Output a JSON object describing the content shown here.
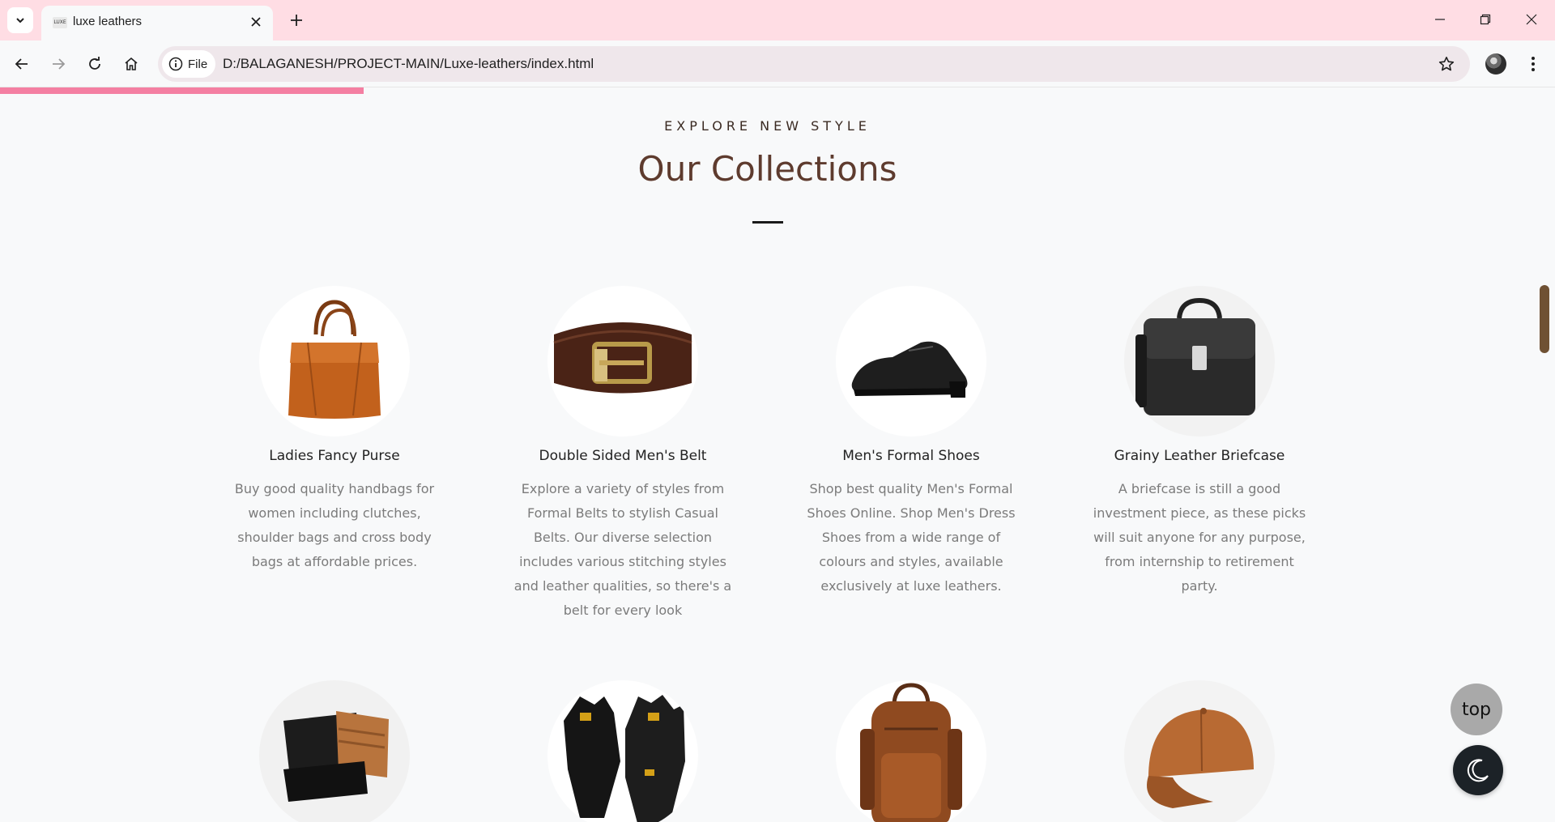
{
  "browser": {
    "tab_title": "luxe leathers",
    "tab_favicon_text": "LUXE",
    "file_chip_label": "File",
    "url": "D:/BALAGANESH/PROJECT-MAIN/Luxe-leathers/index.html"
  },
  "page": {
    "scroll_progress_percent": 23.4,
    "eyebrow": "EXPLORE NEW STYLE",
    "heading": "Our Collections",
    "collections": [
      {
        "title": "Ladies Fancy Purse",
        "description": "Buy good quality handbags for women including clutches, shoulder bags and cross body bags at affordable prices.",
        "icon": "handbag-image"
      },
      {
        "title": "Double Sided Men's Belt",
        "description": "Explore a variety of styles from Formal Belts to stylish Casual Belts. Our diverse selection includes various stitching styles and leather qualities, so there's a belt for every look",
        "icon": "belt-image"
      },
      {
        "title": "Men's Formal Shoes",
        "description": "Shop best quality Men's Formal Shoes Online. Shop Men's Dress Shoes from a wide range of colours and styles, available exclusively at luxe leathers.",
        "icon": "shoe-image"
      },
      {
        "title": "Grainy Leather Briefcase",
        "description": "A briefcase is still a good investment piece, as these picks will suit anyone for any purpose, from internship to retirement party.",
        "icon": "briefcase-image"
      },
      {
        "icon": "wallet-image"
      },
      {
        "icon": "gloves-image"
      },
      {
        "icon": "backpack-image"
      },
      {
        "icon": "cap-image"
      }
    ],
    "top_button_label": "top",
    "dark_mode_icon": "moon-icon"
  },
  "colors": {
    "tabbar_bg": "#ffdde4",
    "progress": "#f47fa2",
    "heading": "#5e3b2e",
    "scroll_thumb": "#6f5133"
  }
}
